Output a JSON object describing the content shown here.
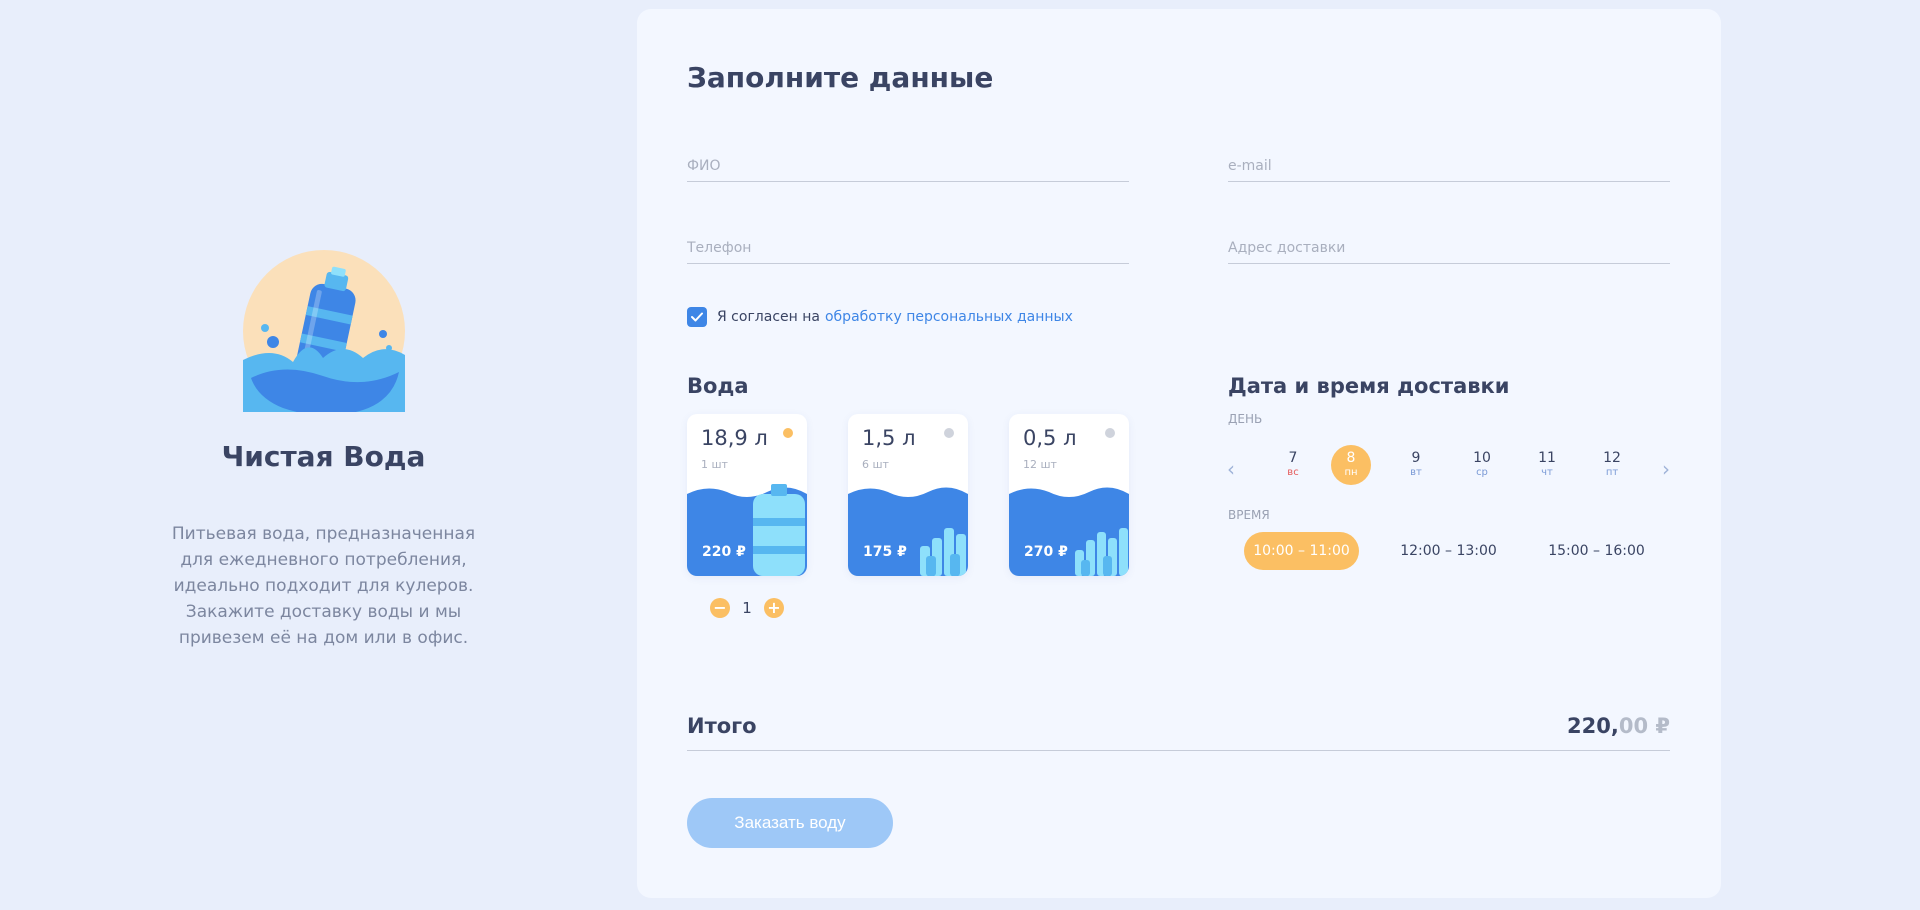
{
  "brand": {
    "title": "Чистая Вода",
    "description": "Питьевая вода, предназначенная для ежедневного потребления, идеально подходит для кулеров. Закажите доставку воды и мы привезем её на дом или в офис.",
    "logo_icon": "water-bottle-splash-icon"
  },
  "form": {
    "title": "Заполните данные",
    "fields": {
      "fio_placeholder": "ФИО",
      "email_placeholder": "e-mail",
      "phone_placeholder": "Телефон",
      "address_placeholder": "Адрес доставки"
    },
    "consent": {
      "checked": true,
      "text": "Я согласен на",
      "link": "обработку персональных данных"
    }
  },
  "water": {
    "title": "Вода",
    "cards": [
      {
        "volume": "18,9 л",
        "qty": "1 шт",
        "price": "220 ₽",
        "selected": true,
        "dot_color": "#fbbf63"
      },
      {
        "volume": "1,5 л",
        "qty": "6 шт",
        "price": "175 ₽",
        "selected": false,
        "dot_color": "#cfd3dc"
      },
      {
        "volume": "0,5 л",
        "qty": "12 шт",
        "price": "270 ₽",
        "selected": false,
        "dot_color": "#cfd3dc"
      }
    ],
    "stepper": {
      "minus": "−",
      "value": "1",
      "plus": "+"
    }
  },
  "delivery": {
    "title": "Дата и время доставки",
    "day_label": "ДЕНЬ",
    "time_label": "ВРЕМЯ",
    "days": [
      {
        "num": "7",
        "wd": "вс",
        "selected": false,
        "weekend": true
      },
      {
        "num": "8",
        "wd": "пн",
        "selected": true,
        "weekend": false
      },
      {
        "num": "9",
        "wd": "вт",
        "selected": false,
        "weekend": false
      },
      {
        "num": "10",
        "wd": "ср",
        "selected": false,
        "weekend": false
      },
      {
        "num": "11",
        "wd": "чт",
        "selected": false,
        "weekend": false
      },
      {
        "num": "12",
        "wd": "пт",
        "selected": false,
        "weekend": false
      }
    ],
    "slots": [
      {
        "label": "10:00 – 11:00",
        "selected": true
      },
      {
        "label": "12:00 – 13:00",
        "selected": false
      },
      {
        "label": "15:00 – 16:00",
        "selected": false
      }
    ],
    "prev_icon": "chevron-left-icon",
    "next_icon": "chevron-right-icon"
  },
  "total": {
    "label": "Итого",
    "amount_main": "220,",
    "amount_cents": "00 ₽"
  },
  "order_button": "Заказать воду",
  "colors": {
    "background": "#e8eefb",
    "panel": "#f3f7ff",
    "accent_orange": "#fbbf63",
    "accent_blue": "#3e86e6",
    "button_disabled": "#9ec8f7",
    "text_dark": "#3a4463"
  }
}
